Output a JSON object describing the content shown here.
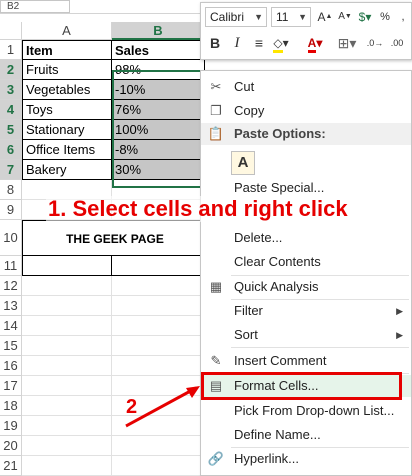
{
  "namebox": {
    "value": "B2"
  },
  "columns": {
    "a": "A",
    "b": "B"
  },
  "rows": [
    "1",
    "2",
    "3",
    "4",
    "5",
    "6",
    "7",
    "8",
    "9",
    "10",
    "11",
    "12",
    "13",
    "14",
    "15",
    "16",
    "17",
    "18",
    "19",
    "20",
    "21"
  ],
  "table": {
    "header": {
      "item": "Item",
      "sales": "Sales"
    },
    "data": [
      {
        "item": "Fruits",
        "sales": "98%"
      },
      {
        "item": "Vegetables",
        "sales": "-10%"
      },
      {
        "item": "Toys",
        "sales": "76%"
      },
      {
        "item": "Stationary",
        "sales": "100%"
      },
      {
        "item": "Office Items",
        "sales": "-8%"
      },
      {
        "item": "Bakery",
        "sales": "30%"
      }
    ],
    "footer_label": "THE GEEK PAGE"
  },
  "minibar": {
    "font": "Calibri",
    "size": "11",
    "bold": "B",
    "italic": "I"
  },
  "menu": {
    "cut": "Cut",
    "copy": "Copy",
    "paste_options": "Paste Options:",
    "paste_special": "Paste Special...",
    "delete": "Delete...",
    "clear_contents": "Clear Contents",
    "quick_analysis": "Quick Analysis",
    "filter": "Filter",
    "sort": "Sort",
    "insert_comment": "Insert Comment",
    "format_cells": "Format Cells...",
    "pick_list": "Pick From Drop-down List...",
    "define_name": "Define Name...",
    "hyperlink": "Hyperlink..."
  },
  "annotations": {
    "step1": "1. Select cells and right click",
    "step2": "2"
  },
  "colors": {
    "accent": "#217346",
    "annotation": "#e60000"
  }
}
